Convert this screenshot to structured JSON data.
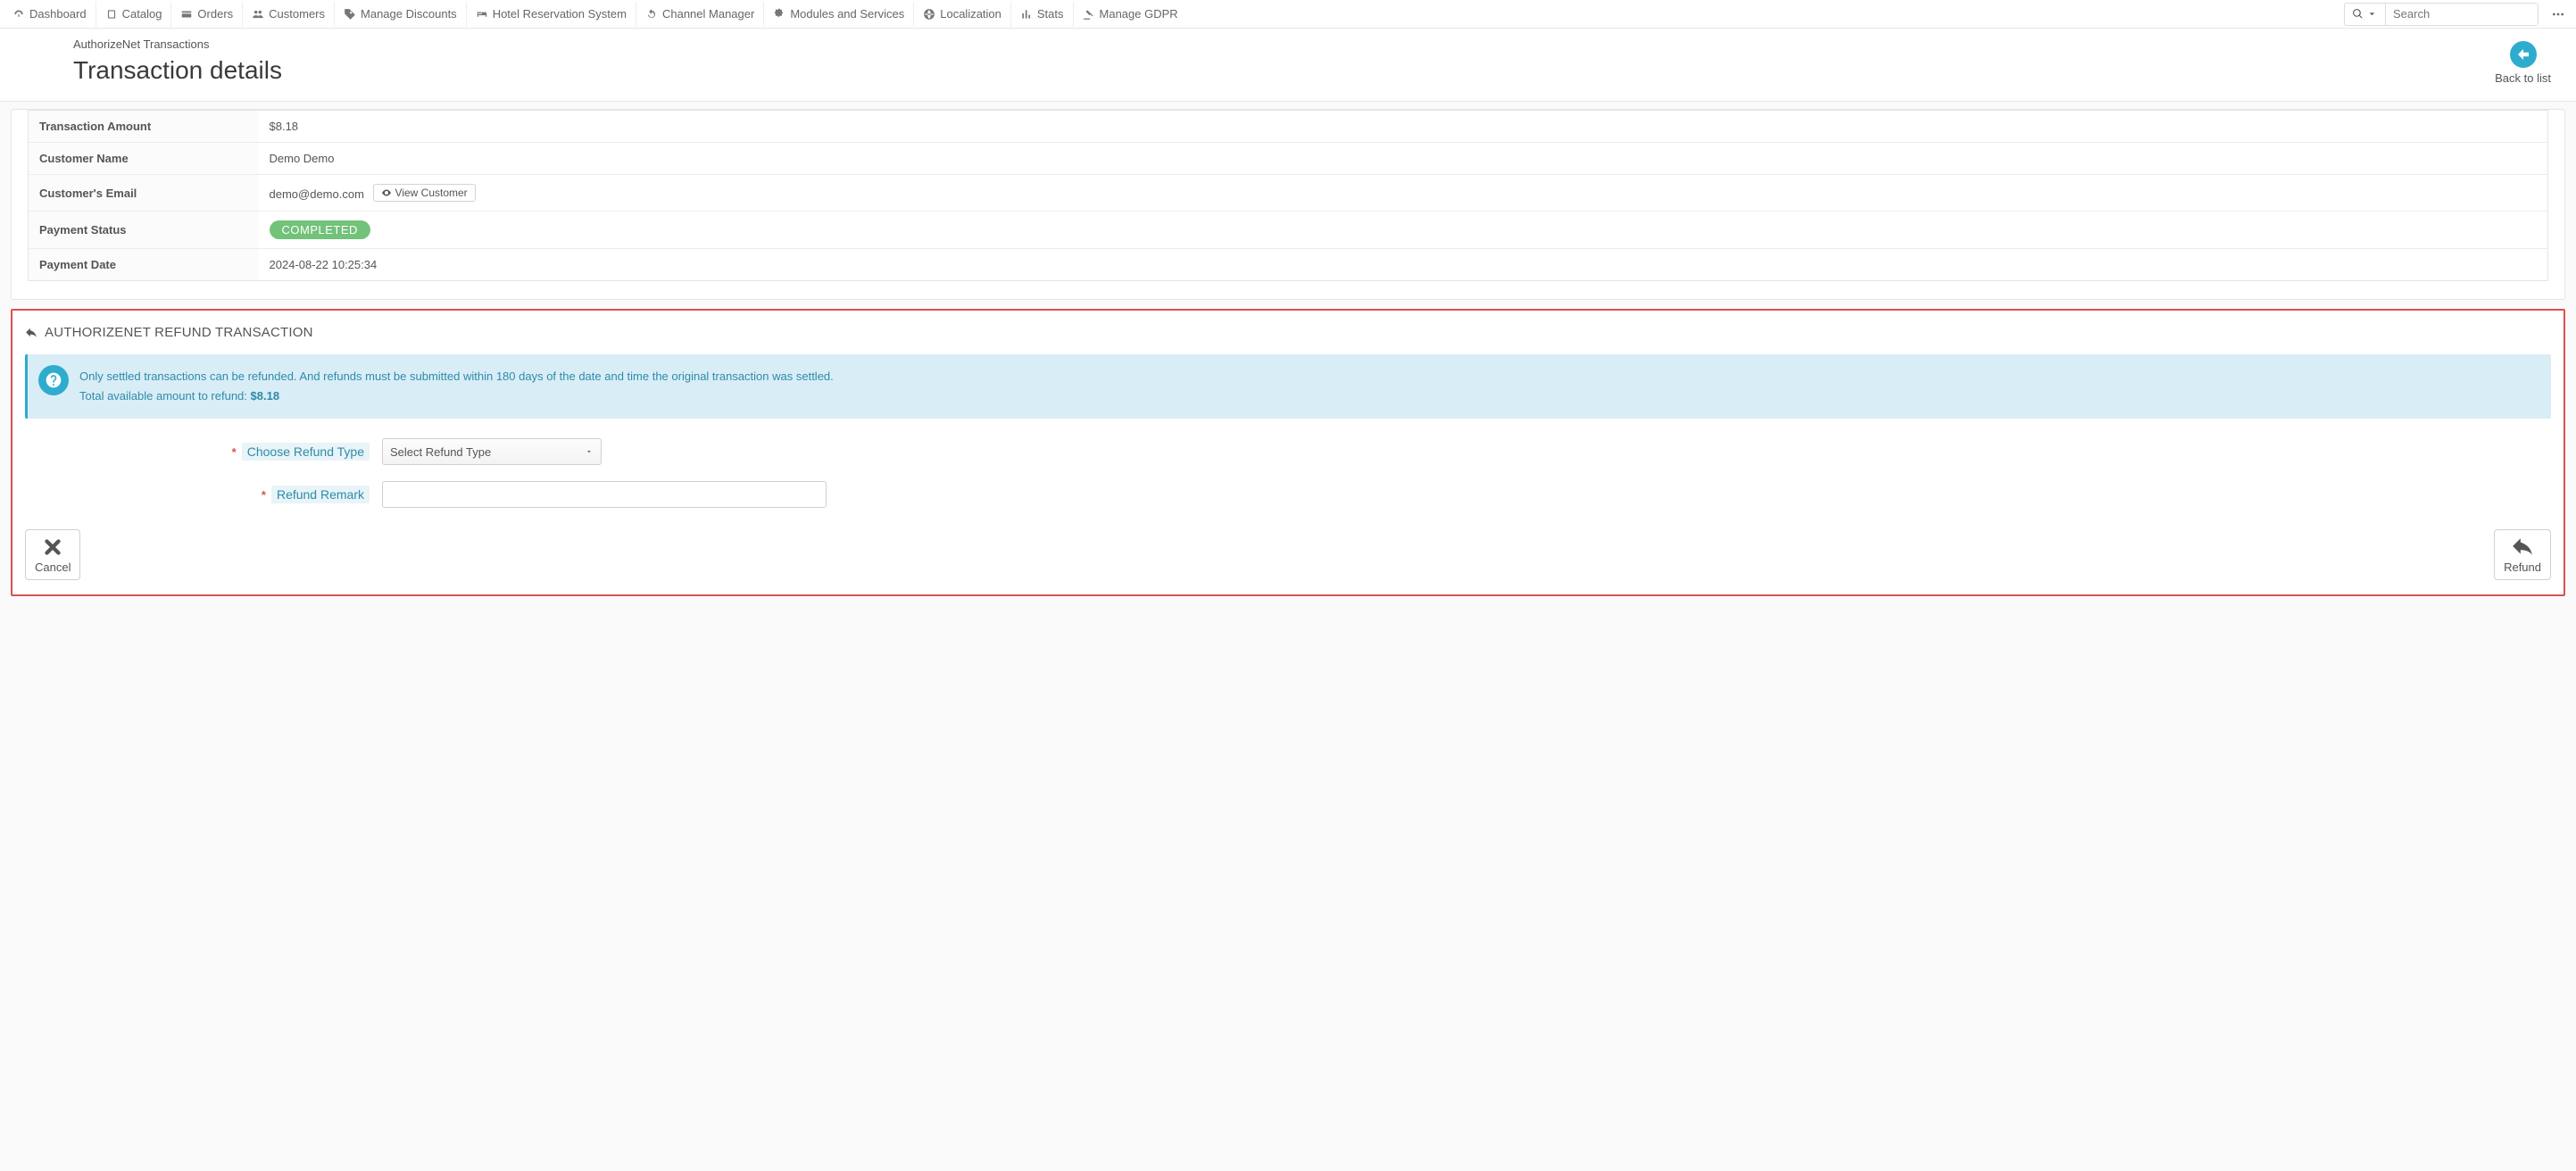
{
  "nav": {
    "items": [
      {
        "label": "Dashboard"
      },
      {
        "label": "Catalog"
      },
      {
        "label": "Orders"
      },
      {
        "label": "Customers"
      },
      {
        "label": "Manage Discounts"
      },
      {
        "label": "Hotel Reservation System"
      },
      {
        "label": "Channel Manager"
      },
      {
        "label": "Modules and Services"
      },
      {
        "label": "Localization"
      },
      {
        "label": "Stats"
      },
      {
        "label": "Manage GDPR"
      }
    ],
    "search_placeholder": "Search"
  },
  "header": {
    "breadcrumb": "AuthorizeNet Transactions",
    "title": "Transaction details",
    "back_label": "Back to list"
  },
  "details": {
    "rows": [
      {
        "label": "Transaction Amount",
        "value": "$8.18"
      },
      {
        "label": "Customer Name",
        "value": "Demo Demo"
      },
      {
        "label": "Customer's Email",
        "value": "demo@demo.com"
      },
      {
        "label": "Payment Status",
        "value": "COMPLETED"
      },
      {
        "label": "Payment Date",
        "value": "2024-08-22 10:25:34"
      }
    ],
    "view_customer_btn": "View Customer"
  },
  "refund": {
    "heading": "AUTHORIZENET REFUND TRANSACTION",
    "info_line1": "Only settled transactions can be refunded. And refunds must be submitted within 180 days of the date and time the original transaction was settled.",
    "info_line2_prefix": "Total available amount to refund: ",
    "info_line2_amount": "$8.18",
    "field_refund_type_label": "Choose Refund Type",
    "field_refund_type_selected": "Select Refund Type",
    "field_refund_remark_label": "Refund Remark",
    "cancel_btn": "Cancel",
    "refund_btn": "Refund"
  }
}
